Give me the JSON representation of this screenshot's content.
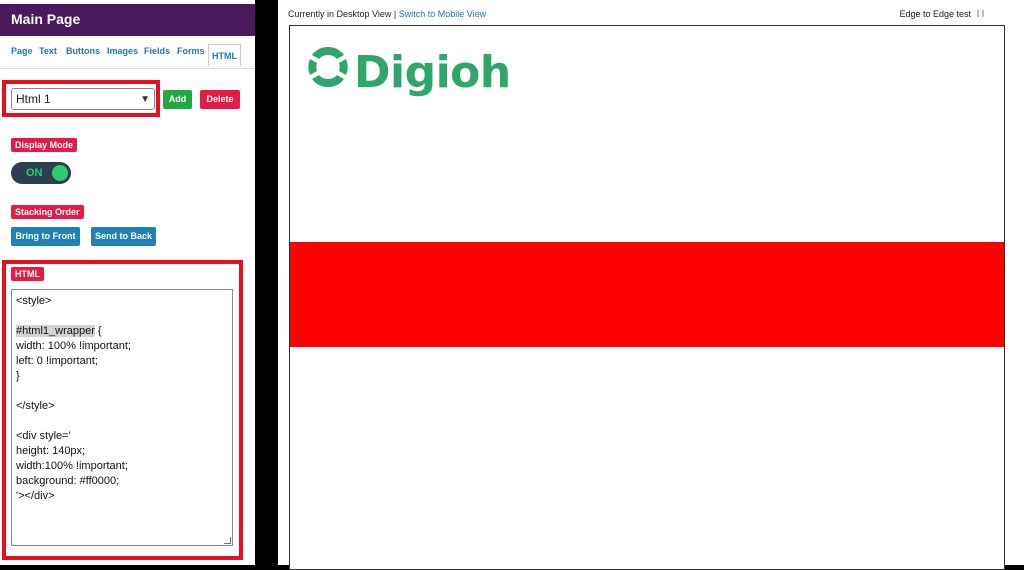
{
  "panel": {
    "title": "Main Page",
    "tabs": [
      "Page",
      "Text",
      "Buttons",
      "Images",
      "Fields",
      "Forms",
      "HTML"
    ],
    "active_tab": "HTML",
    "select_value": "Html 1",
    "add_label": "Add",
    "delete_label": "Delete",
    "display_mode_label": "Display Mode",
    "toggle_state": "ON",
    "stacking_order_label": "Stacking Order",
    "bring_front_label": "Bring to Front",
    "send_back_label": "Send to Back",
    "html_label": "HTML",
    "code_lines": [
      "<style>",
      "",
      "#html1_wrapper {",
      "width: 100% !important;",
      "left: 0 !important;",
      "}",
      "",
      "</style>",
      "",
      "<div style='",
      "height: 140px;",
      "width:100% !important;",
      "background: #ff0000;",
      "'></div>"
    ],
    "code_selected_text": "#html1_wrapper"
  },
  "preview": {
    "view_status": "Currently in Desktop View |",
    "switch_link": "Switch to Mobile View",
    "edge_label": "Edge to Edge test",
    "logo_text": "Digioh",
    "band_color": "#ff0000"
  },
  "colors": {
    "header_bg": "#4a1a5c",
    "accent_red": "#e41b44",
    "accent_green": "#22a745",
    "accent_teal": "#1f82b3",
    "logo_green": "#2ea66c"
  }
}
